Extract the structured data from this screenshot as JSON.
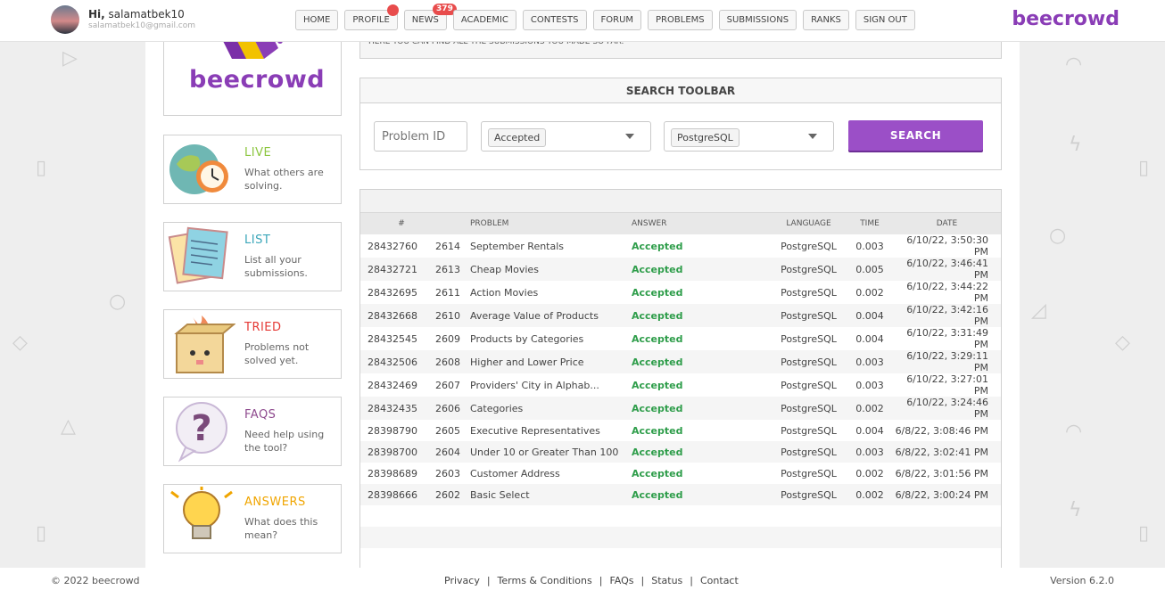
{
  "user": {
    "greeting": "Hi,",
    "name": "salamatbek10",
    "email": "salamatbek10@gmail.com"
  },
  "nav": {
    "items": [
      "HOME",
      "PROFILE",
      "NEWS",
      "ACADEMIC",
      "CONTESTS",
      "FORUM",
      "PROBLEMS",
      "SUBMISSIONS",
      "RANKS",
      "SIGN OUT"
    ],
    "news_badge": "379"
  },
  "brand": "beecrowd",
  "sidebar": {
    "logo_text": "beecrowd",
    "cards": [
      {
        "title": "LIVE",
        "desc": "What others are solving.",
        "color": "#8cc63f"
      },
      {
        "title": "LIST",
        "desc": "List all your submissions.",
        "color": "#3aa6b9"
      },
      {
        "title": "TRIED",
        "desc": "Problems not solved yet.",
        "color": "#e53935"
      },
      {
        "title": "FAQS",
        "desc": "Need help using the tool?",
        "color": "#8e4a8e"
      },
      {
        "title": "ANSWERS",
        "desc": "What does this mean?",
        "color": "#f0a500"
      }
    ]
  },
  "info": "HERE YOU CAN FIND ALL THE SUBMISSIONS YOU MADE SO FAR.",
  "toolbar": {
    "title": "SEARCH TOOLBAR",
    "problem_placeholder": "Problem ID",
    "answer_value": "Accepted",
    "language_value": "PostgreSQL",
    "search_label": "SEARCH"
  },
  "table": {
    "headers": {
      "id": "#",
      "problem": "PROBLEM",
      "answer": "ANSWER",
      "language": "LANGUAGE",
      "time": "TIME",
      "date": "DATE"
    },
    "rows": [
      [
        "28432760",
        "2614",
        "September Rentals",
        "Accepted",
        "PostgreSQL",
        "0.003",
        "6/10/22, 3:50:30 PM"
      ],
      [
        "28432721",
        "2613",
        "Cheap Movies",
        "Accepted",
        "PostgreSQL",
        "0.005",
        "6/10/22, 3:46:41 PM"
      ],
      [
        "28432695",
        "2611",
        "Action Movies",
        "Accepted",
        "PostgreSQL",
        "0.002",
        "6/10/22, 3:44:22 PM"
      ],
      [
        "28432668",
        "2610",
        "Average Value of Products",
        "Accepted",
        "PostgreSQL",
        "0.004",
        "6/10/22, 3:42:16 PM"
      ],
      [
        "28432545",
        "2609",
        "Products by Categories",
        "Accepted",
        "PostgreSQL",
        "0.004",
        "6/10/22, 3:31:49 PM"
      ],
      [
        "28432506",
        "2608",
        "Higher and Lower Price",
        "Accepted",
        "PostgreSQL",
        "0.003",
        "6/10/22, 3:29:11 PM"
      ],
      [
        "28432469",
        "2607",
        "Providers' City in Alphab...",
        "Accepted",
        "PostgreSQL",
        "0.003",
        "6/10/22, 3:27:01 PM"
      ],
      [
        "28432435",
        "2606",
        "Categories",
        "Accepted",
        "PostgreSQL",
        "0.002",
        "6/10/22, 3:24:46 PM"
      ],
      [
        "28398790",
        "2605",
        "Executive Representatives",
        "Accepted",
        "PostgreSQL",
        "0.004",
        "6/8/22, 3:08:46 PM"
      ],
      [
        "28398700",
        "2604",
        "Under 10 or Greater Than 100",
        "Accepted",
        "PostgreSQL",
        "0.003",
        "6/8/22, 3:02:41 PM"
      ],
      [
        "28398689",
        "2603",
        "Customer Address",
        "Accepted",
        "PostgreSQL",
        "0.002",
        "6/8/22, 3:01:56 PM"
      ],
      [
        "28398666",
        "2602",
        "Basic Select",
        "Accepted",
        "PostgreSQL",
        "0.002",
        "6/8/22, 3:00:24 PM"
      ]
    ]
  },
  "footer": {
    "copyright": "© 2022 beecrowd",
    "links": [
      "Privacy",
      "Terms & Conditions",
      "FAQs",
      "Status",
      "Contact"
    ],
    "version": "Version 6.2.0"
  }
}
